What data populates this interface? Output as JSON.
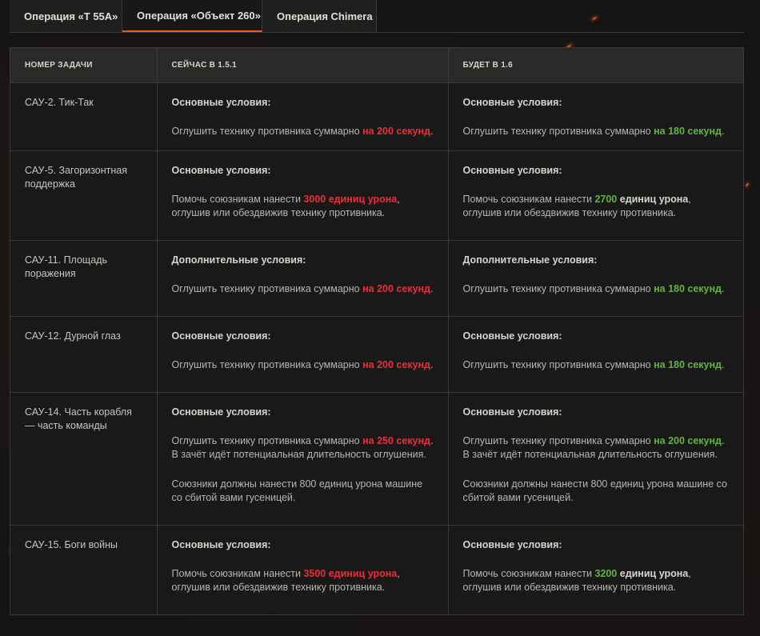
{
  "tabs": [
    {
      "label": "Операция «Т 55А»"
    },
    {
      "label": "Операция «Объект 260»"
    },
    {
      "label": "Операция Chimera"
    }
  ],
  "table": {
    "headers": [
      "НОМЕР ЗАДАЧИ",
      "СЕЙЧАС В 1.5.1",
      "БУДЕТ В 1.6"
    ],
    "rows": [
      {
        "task": "САУ-2. Тик-Так",
        "now": {
          "title": "Основные условия:",
          "p1_pre": "Оглушить технику противника суммарно ",
          "p1_hl": "на 200 секунд",
          "p1_post": "."
        },
        "next": {
          "title": "Основные условия:",
          "p1_pre": "Оглушить технику противника суммарно ",
          "p1_hl": "на 180 секунд",
          "p1_post": "."
        }
      },
      {
        "task": "САУ-5. Загоризонтная поддержка",
        "now": {
          "title": "Основные условия:",
          "p1_pre": "Помочь союзникам нанести ",
          "p1_hl": "3000 единиц урона",
          "p1_post": ", оглушив или обездвижив технику противника."
        },
        "next": {
          "title": "Основные условия:",
          "p1_pre": "Помочь союзникам нанести ",
          "p1_hl": "2700",
          "p1_bold": " единиц урона",
          "p1_post": ", оглушив или обездвижив технику противника."
        }
      },
      {
        "task": "САУ-11. Площадь поражения",
        "now": {
          "title": "Дополнительные условия:",
          "p1_pre": "Оглушить технику противника суммарно ",
          "p1_hl": "на 200 секунд",
          "p1_post": "."
        },
        "next": {
          "title": "Дополнительные условия:",
          "p1_pre": "Оглушить технику противника суммарно ",
          "p1_hl": "на 180 секунд",
          "p1_post": "."
        }
      },
      {
        "task": "САУ-12. Дурной глаз",
        "now": {
          "title": "Основные условия:",
          "p1_pre": "Оглушить технику противника суммарно ",
          "p1_hl": "на 200 секунд",
          "p1_post": "."
        },
        "next": {
          "title": "Основные условия:",
          "p1_pre": "Оглушить технику противника суммарно ",
          "p1_hl": "на 180 секунд",
          "p1_post": "."
        }
      },
      {
        "task": "САУ-14. Часть корабля — часть команды",
        "now": {
          "title": "Основные условия:",
          "p1_pre": "Оглушить технику противника суммарно ",
          "p1_hl": "на 250 секунд",
          "p1_post": ". В зачёт идёт потенциальная длительность оглушения.",
          "p2": "Союзники должны нанести 800 единиц урона машине со сбитой вами гусеницей."
        },
        "next": {
          "title": "Основные условия:",
          "p1_pre": "Оглушить технику противника суммарно ",
          "p1_hl": "на 200 секунд",
          "p1_post": ". В зачёт идёт потенциальная длительность оглушения.",
          "p2": "Союзники должны нанести 800 единиц урона машине со сбитой вами гусеницей."
        }
      },
      {
        "task": "САУ-15. Боги войны",
        "now": {
          "title": "Основные условия:",
          "p1_pre": "Помочь союзникам нанести ",
          "p1_hl": "3500 единиц урона",
          "p1_post": ", оглушив или обездвижив технику противника."
        },
        "next": {
          "title": "Основные условия:",
          "p1_pre": "Помочь союзникам нанести ",
          "p1_hl": "3200",
          "p1_bold": " единиц урона",
          "p1_post": ", оглушив или обездвижив технику противника."
        }
      }
    ]
  },
  "colors": {
    "accent": "#f2581e",
    "old_value": "#e8303a",
    "new_value": "#62b33f"
  }
}
